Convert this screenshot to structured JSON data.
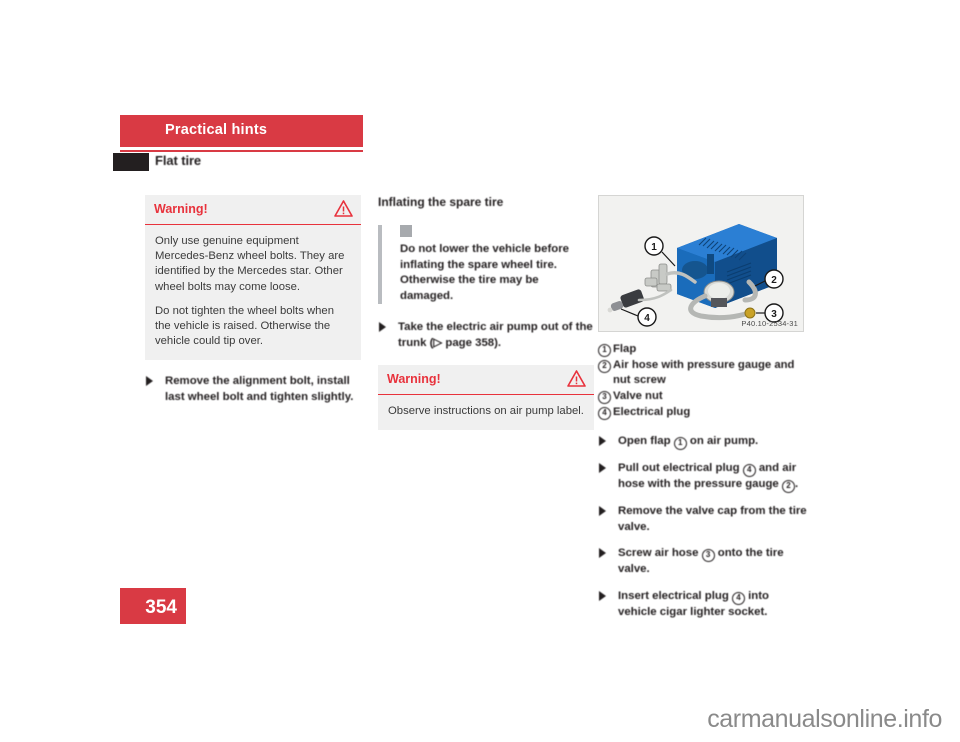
{
  "header": {
    "chapter_title": "Practical hints",
    "section_title": "Flat tire",
    "bar_color": "#d93a44"
  },
  "left_column": {
    "warning": {
      "title": "Warning!",
      "icon": "warning-triangle-icon",
      "paragraphs": [
        "Only use genuine equipment Mercedes-Benz wheel bolts. They are identified by the Mercedes star. Other wheel bolts may come loose.",
        "Do not tighten the wheel bolts when the vehicle is raised. Otherwise the vehicle could tip over."
      ]
    },
    "step": "Remove the alignment bolt, install last wheel bolt and tighten slightly."
  },
  "middle_column": {
    "heading": "Inflating the spare tire",
    "note": {
      "icon": "caution-square-icon",
      "text": "Do not lower the vehicle before inflating the spare wheel tire. Otherwise the tire may be damaged."
    },
    "step": "Take the electric air pump out of the trunk (▷ page 358).",
    "warning": {
      "title": "Warning!",
      "icon": "warning-triangle-icon",
      "text": "Observe instructions on air pump label."
    }
  },
  "right_column": {
    "figure": {
      "caption": "P40.10-2534-31",
      "alt": "Electric air pump with hose, pressure gauge, valve nut and electrical plug",
      "callouts": [
        "1",
        "2",
        "3",
        "4"
      ]
    },
    "legend": [
      {
        "num": "1",
        "label": "Flap"
      },
      {
        "num": "2",
        "label": "Air hose with pressure gauge and nut screw"
      },
      {
        "num": "3",
        "label": "Valve nut"
      },
      {
        "num": "4",
        "label": "Electrical plug"
      }
    ],
    "steps": [
      {
        "parts": [
          "Open flap ",
          "1",
          " on air pump."
        ]
      },
      {
        "parts": [
          "Pull out electrical plug ",
          "4",
          " and air hose with the pressure gauge ",
          "2",
          "."
        ]
      },
      {
        "parts": [
          "Remove the valve cap from the tire valve."
        ]
      },
      {
        "parts": [
          "Screw air hose ",
          "3",
          " onto the tire valve."
        ]
      },
      {
        "parts": [
          "Insert electrical plug ",
          "4",
          " into vehicle cigar lighter socket."
        ]
      }
    ]
  },
  "footer": {
    "page_number": "354",
    "watermark": "carmanualsonline.info"
  }
}
